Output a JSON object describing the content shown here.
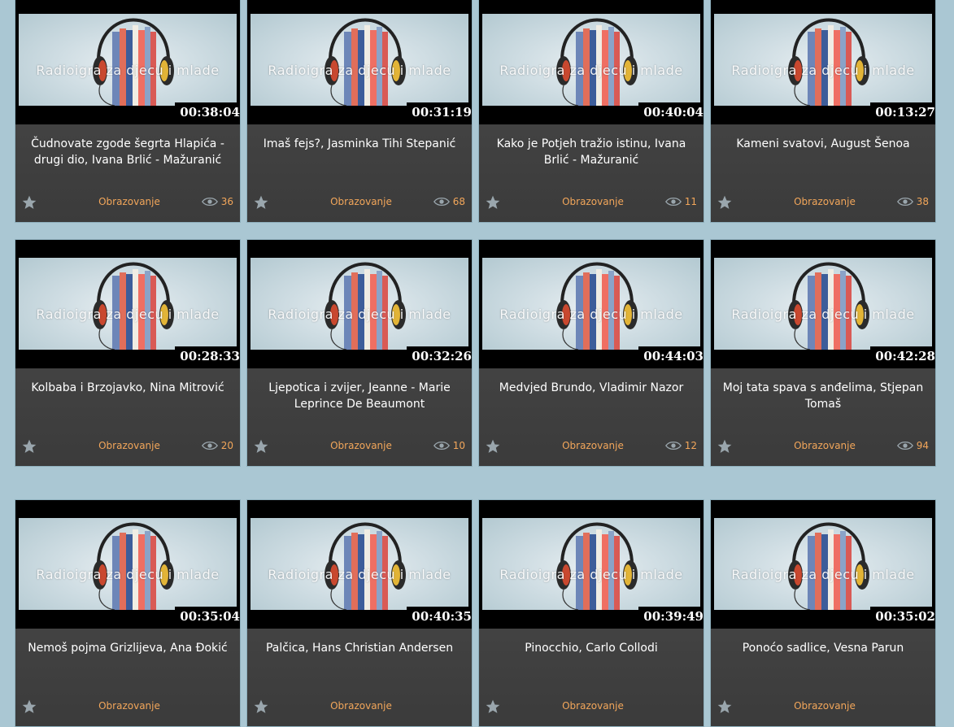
{
  "watermark_text": "Radioigra za djecu i mlade",
  "category_label": "Obrazovanje",
  "cards": [
    {
      "duration": "00:38:04",
      "title": "Čudnovate zgode šegrta Hlapića - drugi dio, Ivana Brlić - Mažuranić",
      "views": "36"
    },
    {
      "duration": "00:31:19",
      "title": "Imaš fejs?, Jasminka Tihi Stepanić",
      "views": "68"
    },
    {
      "duration": "00:40:04",
      "title": "Kako je Potjeh tražio istinu, Ivana Brlić - Mažuranić",
      "views": "11"
    },
    {
      "duration": "00:13:27",
      "title": "Kameni svatovi, August Šenoa",
      "views": "38"
    },
    {
      "duration": "00:28:33",
      "title": "Kolbaba i Brzojavko, Nina Mitrović",
      "views": "20"
    },
    {
      "duration": "00:32:26",
      "title": "Ljepotica i zvijer, Jeanne - Marie Leprince De Beaumont",
      "views": "10"
    },
    {
      "duration": "00:44:03",
      "title": "Medvjed Brundo, Vladimir Nazor",
      "views": "12"
    },
    {
      "duration": "00:42:28",
      "title": "Moj tata spava s anđelima, Stjepan Tomaš",
      "views": "94"
    },
    {
      "duration": "00:35:04",
      "title": "Nemoš pojma Grizlijeva, Ana Đokić",
      "views": ""
    },
    {
      "duration": "00:40:35",
      "title": "Palčica, Hans Christian Andersen",
      "views": ""
    },
    {
      "duration": "00:39:49",
      "title": "Pinocchio, Carlo Collodi",
      "views": ""
    },
    {
      "duration": "00:35:02",
      "title": "Ponoćo sadlice, Vesna Parun",
      "views": ""
    }
  ],
  "colors": {
    "background": "#aac7d3",
    "card": "#454545",
    "accent": "#f2a65a"
  },
  "icons": {
    "favorite": "star-icon",
    "views": "eye-icon",
    "thumbnail": "headphones-books-image"
  }
}
